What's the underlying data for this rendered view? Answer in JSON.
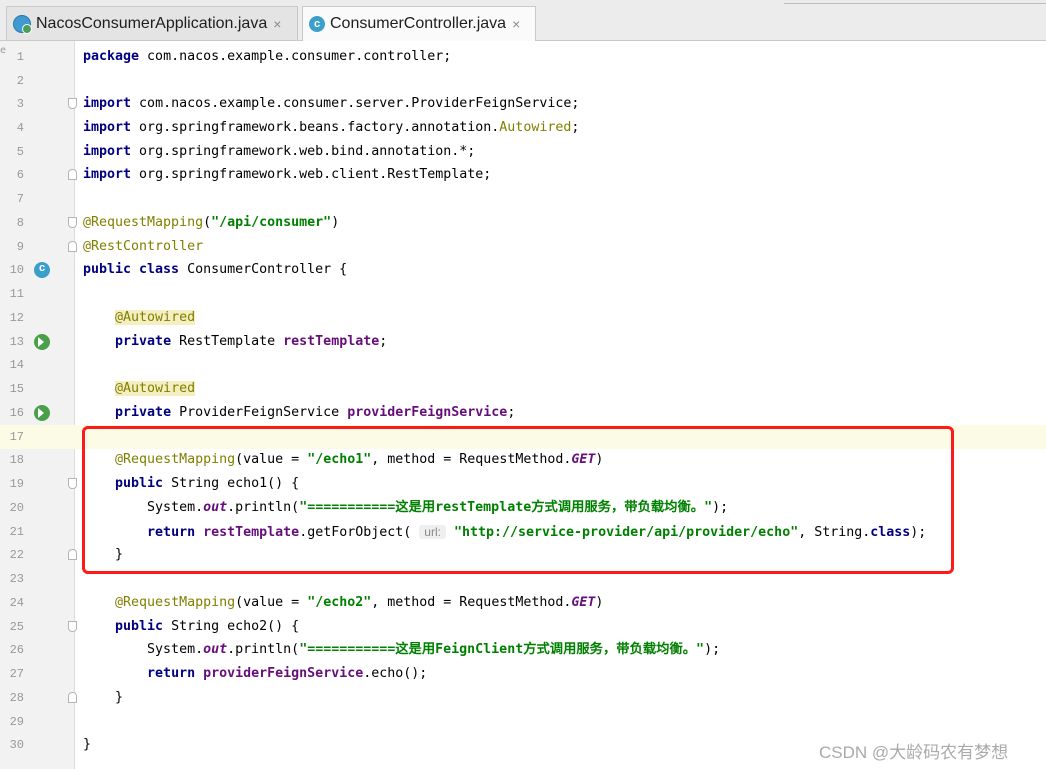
{
  "tabs": [
    {
      "label": "NacosConsumerApplication.java",
      "close": "×",
      "icon": "spring-app-icon"
    },
    {
      "label": "ConsumerController.java",
      "close": "×",
      "icon": "java-class-icon",
      "icon_letter": "c"
    }
  ],
  "gutter": {
    "left_mark": "e"
  },
  "lines": [
    {
      "n": "1",
      "code": "package com.nacos.example.consumer.controller;"
    },
    {
      "n": "2",
      "code": ""
    },
    {
      "n": "3",
      "code": "import com.nacos.example.consumer.server.ProviderFeignService;"
    },
    {
      "n": "4",
      "code": "import org.springframework.beans.factory.annotation.Autowired;"
    },
    {
      "n": "5",
      "code": "import org.springframework.web.bind.annotation.*;"
    },
    {
      "n": "6",
      "code": "import org.springframework.web.client.RestTemplate;"
    },
    {
      "n": "7",
      "code": ""
    },
    {
      "n": "8",
      "code": "@RequestMapping(\"/api/consumer\")"
    },
    {
      "n": "9",
      "code": "@RestController"
    },
    {
      "n": "10",
      "code": "public class ConsumerController {"
    },
    {
      "n": "11",
      "code": ""
    },
    {
      "n": "12",
      "code": "    @Autowired"
    },
    {
      "n": "13",
      "code": "    private RestTemplate restTemplate;"
    },
    {
      "n": "14",
      "code": ""
    },
    {
      "n": "15",
      "code": "    @Autowired"
    },
    {
      "n": "16",
      "code": "    private ProviderFeignService providerFeignService;"
    },
    {
      "n": "17",
      "code": ""
    },
    {
      "n": "18",
      "code": "    @RequestMapping(value = \"/echo1\", method = RequestMethod.GET)"
    },
    {
      "n": "19",
      "code": "    public String echo1() {"
    },
    {
      "n": "20",
      "code": "        System.out.println(\"===========这是用restTemplate方式调用服务，带负载均衡。\");"
    },
    {
      "n": "21",
      "code": "        return restTemplate.getForObject( url: \"http://service-provider/api/provider/echo\", String.class);"
    },
    {
      "n": "22",
      "code": "    }"
    },
    {
      "n": "23",
      "code": ""
    },
    {
      "n": "24",
      "code": "    @RequestMapping(value = \"/echo2\", method = RequestMethod.GET)"
    },
    {
      "n": "25",
      "code": "    public String echo2() {"
    },
    {
      "n": "26",
      "code": "        System.out.println(\"===========这是用FeignClient方式调用服务，带负载均衡。\");"
    },
    {
      "n": "27",
      "code": "        return providerFeignService.echo();"
    },
    {
      "n": "28",
      "code": "    }"
    },
    {
      "n": "29",
      "code": ""
    },
    {
      "n": "30",
      "code": "}"
    }
  ],
  "parameter_hint": "url:",
  "watermark": "CSDN @大龄码农有梦想",
  "colors": {
    "keyword": "#000080",
    "annotation": "#808000",
    "string": "#008000",
    "field": "#660e7a",
    "highlight_box": "#ff1a1a"
  }
}
